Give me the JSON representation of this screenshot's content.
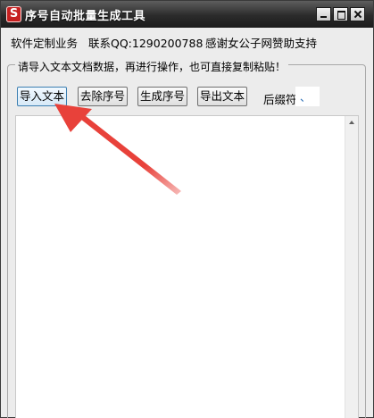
{
  "window": {
    "title": "序号自动批量生成工具",
    "icon_glyph": "S",
    "controls": {
      "minimize": "minimize",
      "maximize": "maximize",
      "close": "close"
    }
  },
  "menu": {
    "items": [
      {
        "label": "软件定制业务"
      },
      {
        "label": "联系QQ:1290200788"
      },
      {
        "label": "感谢女公子网赞助支持"
      }
    ]
  },
  "group": {
    "legend": "请导入文本文档数据，再进行操作，也可直接复制粘贴！"
  },
  "toolbar": {
    "import_label": "导入文本",
    "remove_index_label": "去除序号",
    "generate_index_label": "生成序号",
    "export_label": "导出文本",
    "suffix_label": "后缀符",
    "suffix_value": "、"
  },
  "editor": {
    "value": ""
  },
  "colors": {
    "annotation_arrow": "#e8413a",
    "titlebar": "#2b2b2b",
    "app_icon": "#c62020"
  }
}
